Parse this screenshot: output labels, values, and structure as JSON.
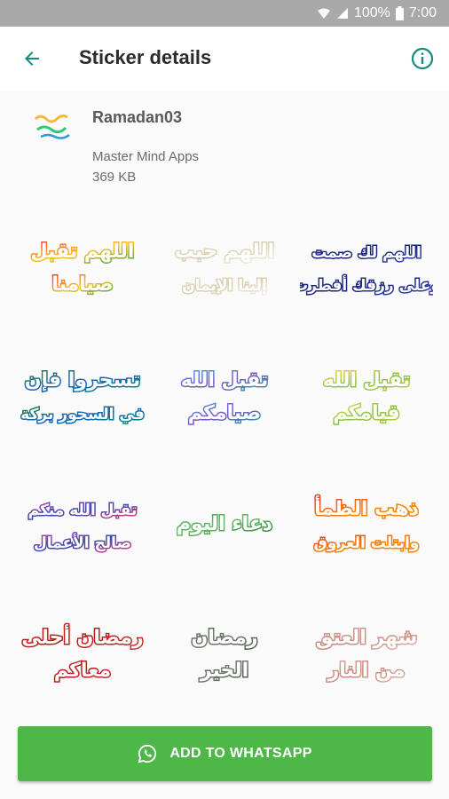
{
  "status_bar": {
    "battery_text": "100%",
    "time": "7:00"
  },
  "app_bar": {
    "title": "Sticker details",
    "back_icon": "arrow-back-icon",
    "info_icon": "info-icon"
  },
  "pack": {
    "name": "Ramadan03",
    "publisher": "Master Mind Apps",
    "size": "369 KB"
  },
  "stickers": [
    {
      "text1": "اللهم تقبل",
      "text2": "صيامنا",
      "colors": [
        "#e53935",
        "#fbc02d",
        "#43a047"
      ]
    },
    {
      "text1": "اللهم حبب",
      "text2": "إلينا الإيمان",
      "colors": [
        "#e8e0c8",
        "#d7cfb0",
        "#f4f1e6"
      ]
    },
    {
      "text1": "اللهم لك صمت",
      "text2": "وعلى رزقك أفطرت",
      "colors": [
        "#283593",
        "#1a237e",
        "#3949ab"
      ]
    },
    {
      "text1": "تسحروا فإن",
      "text2": "في السحور بركة",
      "colors": [
        "#2e7d32",
        "#1565c0",
        "#00897b"
      ]
    },
    {
      "text1": "تقبل الله",
      "text2": "صيامكم",
      "colors": [
        "#42a5f5",
        "#7e57c2",
        "#26a69a"
      ]
    },
    {
      "text1": "تقبل الله",
      "text2": "قيامكم",
      "colors": [
        "#fdd835",
        "#8bc34a",
        "#c0ca33"
      ]
    },
    {
      "text1": "تقبل الله منكم",
      "text2": "صالح الأعمال",
      "colors": [
        "#ab47bc",
        "#3949ab",
        "#ec407a"
      ]
    },
    {
      "text1": "دعاء اليوم",
      "text2": "",
      "colors": [
        "#43a047",
        "#66bb6a",
        "#2e7d32"
      ]
    },
    {
      "text1": "ذهب الظمأ",
      "text2": "وابتلت العروق",
      "colors": [
        "#e53935",
        "#f57c00",
        "#fb8c00"
      ]
    },
    {
      "text1": "رمضان أحلى",
      "text2": "معاكم",
      "colors": [
        "#c62828",
        "#b71c1c",
        "#d32f2f"
      ]
    },
    {
      "text1": "رمضان",
      "text2": "الخير",
      "colors": [
        "#5d6b5a",
        "#707a6e",
        "#4e5b4b"
      ]
    },
    {
      "text1": "شهر العتق",
      "text2": "من النار",
      "colors": [
        "#d7a7a0",
        "#c98b7f",
        "#e0b3a8"
      ]
    }
  ],
  "add_button": {
    "label": "ADD TO WHATSAPP",
    "icon": "whatsapp-icon",
    "color": "#4db848"
  }
}
